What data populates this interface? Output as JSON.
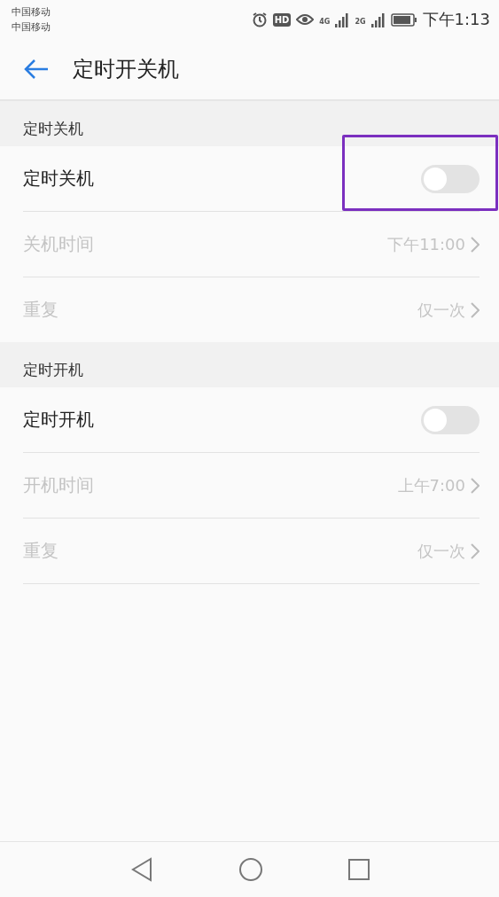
{
  "status_bar": {
    "carriers": [
      "中国移动",
      "中国移动"
    ],
    "hd_badge": "HD",
    "networks": [
      "4G",
      "2G"
    ],
    "time": "下午1:13"
  },
  "header": {
    "title": "定时开关机"
  },
  "sections": [
    {
      "title": "定时关机",
      "rows": [
        {
          "kind": "switch",
          "label": "定时关机",
          "on": false,
          "highlighted": true
        },
        {
          "kind": "link",
          "label": "关机时间",
          "value": "下午11:00",
          "disabled": true
        },
        {
          "kind": "link",
          "label": "重复",
          "value": "仅一次",
          "disabled": true
        }
      ]
    },
    {
      "title": "定时开机",
      "rows": [
        {
          "kind": "switch",
          "label": "定时开机",
          "on": false,
          "highlighted": false
        },
        {
          "kind": "link",
          "label": "开机时间",
          "value": "上午7:00",
          "disabled": true
        },
        {
          "kind": "link",
          "label": "重复",
          "value": "仅一次",
          "disabled": true
        }
      ]
    }
  ]
}
